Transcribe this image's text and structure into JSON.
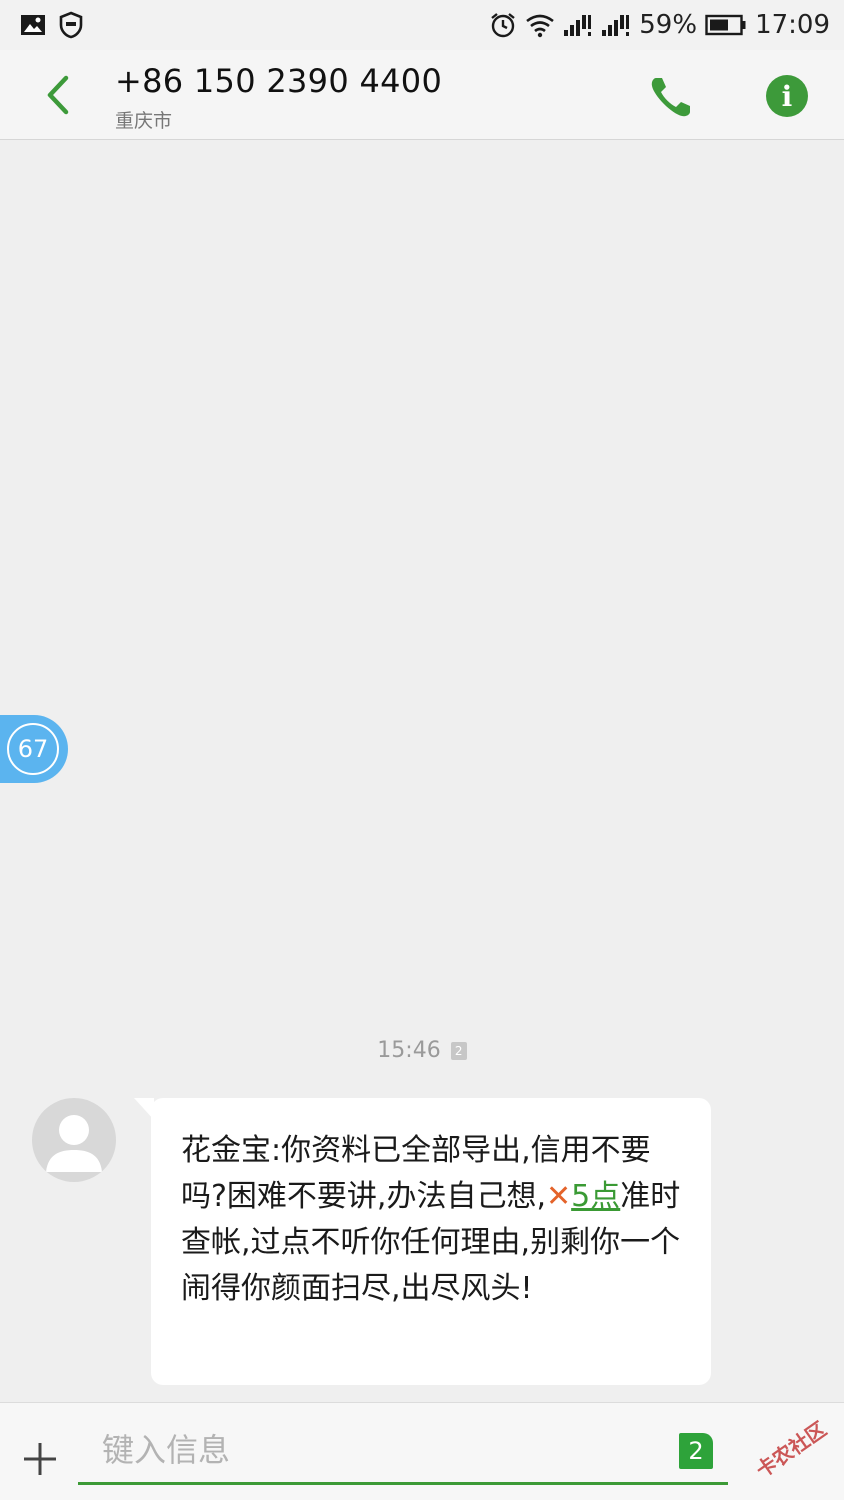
{
  "status_bar": {
    "battery": "59%",
    "time": "17:09"
  },
  "header": {
    "contact_number": "+86 150 2390 4400",
    "location": "重庆市"
  },
  "float_badge": {
    "count": "67"
  },
  "conversation": {
    "timestamp": "15:46",
    "sim_slot": "2",
    "message": {
      "part1": "花金宝:你资料已全部导出,信用不要吗?困难不要讲,办法自己想,",
      "xmark": "✕",
      "link": "5点",
      "part2": "准时查帐,过点不听你任何理由,别剩你一个闹得你颜面扫尽,出尽风头!"
    }
  },
  "composer": {
    "placeholder": "键入信息",
    "sim_slot": "2"
  },
  "watermark": {
    "text": "卡农社区"
  },
  "colors": {
    "accent_green": "#3d9a3a",
    "badge_blue": "#5bb4ef",
    "xmark_orange": "#e4632a"
  }
}
